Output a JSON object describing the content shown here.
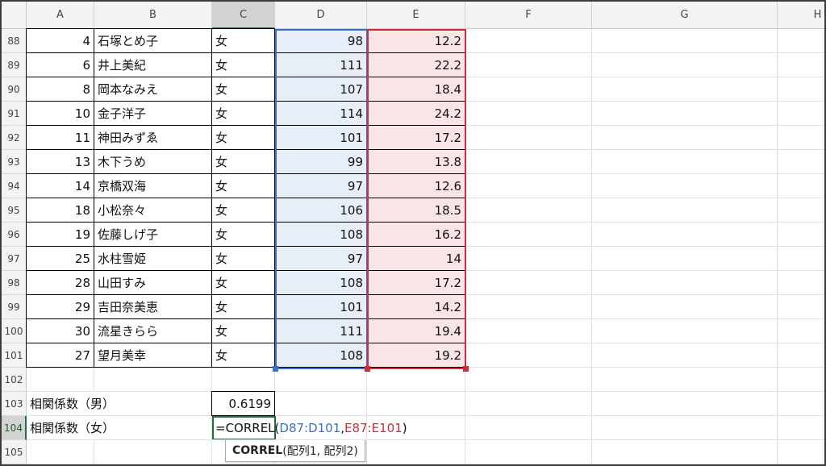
{
  "columns": [
    "A",
    "B",
    "C",
    "D",
    "E",
    "F",
    "G",
    "H"
  ],
  "active_column": "C",
  "rows": [
    {
      "row": "88",
      "id": "4",
      "name": "石塚とめ子",
      "gender": "女",
      "d": "98",
      "e": "12.2"
    },
    {
      "row": "89",
      "id": "6",
      "name": "井上美紀",
      "gender": "女",
      "d": "111",
      "e": "22.2"
    },
    {
      "row": "90",
      "id": "8",
      "name": "岡本なみえ",
      "gender": "女",
      "d": "107",
      "e": "18.4"
    },
    {
      "row": "91",
      "id": "10",
      "name": "金子洋子",
      "gender": "女",
      "d": "114",
      "e": "24.2"
    },
    {
      "row": "92",
      "id": "11",
      "name": "神田みずゑ",
      "gender": "女",
      "d": "101",
      "e": "17.2"
    },
    {
      "row": "93",
      "id": "13",
      "name": "木下うめ",
      "gender": "女",
      "d": "99",
      "e": "13.8"
    },
    {
      "row": "94",
      "id": "14",
      "name": "京橋双海",
      "gender": "女",
      "d": "97",
      "e": "12.6"
    },
    {
      "row": "95",
      "id": "18",
      "name": "小松奈々",
      "gender": "女",
      "d": "106",
      "e": "18.5"
    },
    {
      "row": "96",
      "id": "19",
      "name": "佐藤しげ子",
      "gender": "女",
      "d": "108",
      "e": "16.2"
    },
    {
      "row": "97",
      "id": "25",
      "name": "水柱雪姫",
      "gender": "女",
      "d": "97",
      "e": "14"
    },
    {
      "row": "98",
      "id": "28",
      "name": "山田すみ",
      "gender": "女",
      "d": "108",
      "e": "17.2"
    },
    {
      "row": "99",
      "id": "29",
      "name": "吉田奈美恵",
      "gender": "女",
      "d": "101",
      "e": "14.2"
    },
    {
      "row": "100",
      "id": "30",
      "name": "流星きらら",
      "gender": "女",
      "d": "111",
      "e": "19.4"
    },
    {
      "row": "101",
      "id": "27",
      "name": "望月美幸",
      "gender": "女",
      "d": "108",
      "e": "19.2"
    }
  ],
  "extra_rows": [
    "102",
    "103",
    "104",
    "105"
  ],
  "active_row": "104",
  "labels": {
    "r103": "相関係数（男）",
    "r104": "相関係数（女）"
  },
  "c103_value": "0.6199",
  "formula": {
    "prefix": "=CORREL(",
    "ref1": "D87:D101",
    "sep": ",",
    "ref2": "E87:E101",
    "suffix": ")"
  },
  "tooltip": {
    "func": "CORREL",
    "args": "(配列1, 配列2)"
  },
  "colors": {
    "selection": "#1e6f3a",
    "ref1": "#3a6fd0",
    "ref2": "#c8303d"
  }
}
